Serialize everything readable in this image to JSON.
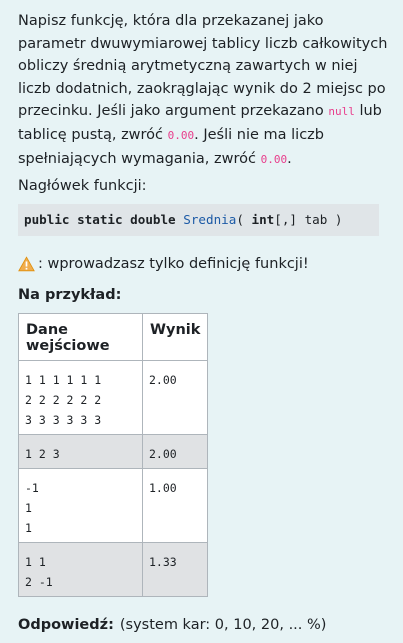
{
  "task": {
    "part1": "Napisz funkcję, która dla przekazanej jako parametr dwuwymiarowej tablicy liczb całkowitych obliczy średnią arytmetyczną zawartych w niej liczb dodatnich, zaokrąglając wynik do 2 miejsc po przecinku. Jeśli jako argument przekazano ",
    "null_code": "null",
    "part2": " lub tablicę pustą, zwróć ",
    "zero_code1": "0.00",
    "part3": ". Jeśli nie ma liczb spełniających wymagania, zwróć ",
    "zero_code2": "0.00",
    "part4": "."
  },
  "header_label": "Nagłówek funkcji:",
  "signature": {
    "kw1": "public static double",
    "name": "Srednia",
    "open": "( ",
    "kw2": "int",
    "rest": "[,] tab )"
  },
  "warning_text": ": wprowadzasz tylko definicję funkcji!",
  "example_label": "Na przykład:",
  "table": {
    "headers": [
      "Dane wejściowe",
      "Wynik"
    ],
    "rows": [
      {
        "input": "1 1 1 1 1 1\n2 2 2 2 2 2\n3 3 3 3 3 3",
        "output": "2.00"
      },
      {
        "input": "1 2 3",
        "output": "2.00"
      },
      {
        "input": "-1\n1\n1",
        "output": "1.00"
      },
      {
        "input": "1 1\n2 -1",
        "output": "1.33"
      }
    ]
  },
  "answer": {
    "label": "Odpowiedź:",
    "penalty": "(system kar: 0, 10, 20, ... %)"
  },
  "icons": {
    "warning": "warning-triangle-icon"
  },
  "colors": {
    "background": "#e7f3f5",
    "code_inline": "#e83e8c",
    "function_name": "#1c5aa6",
    "warning": "#f0ad4e"
  }
}
